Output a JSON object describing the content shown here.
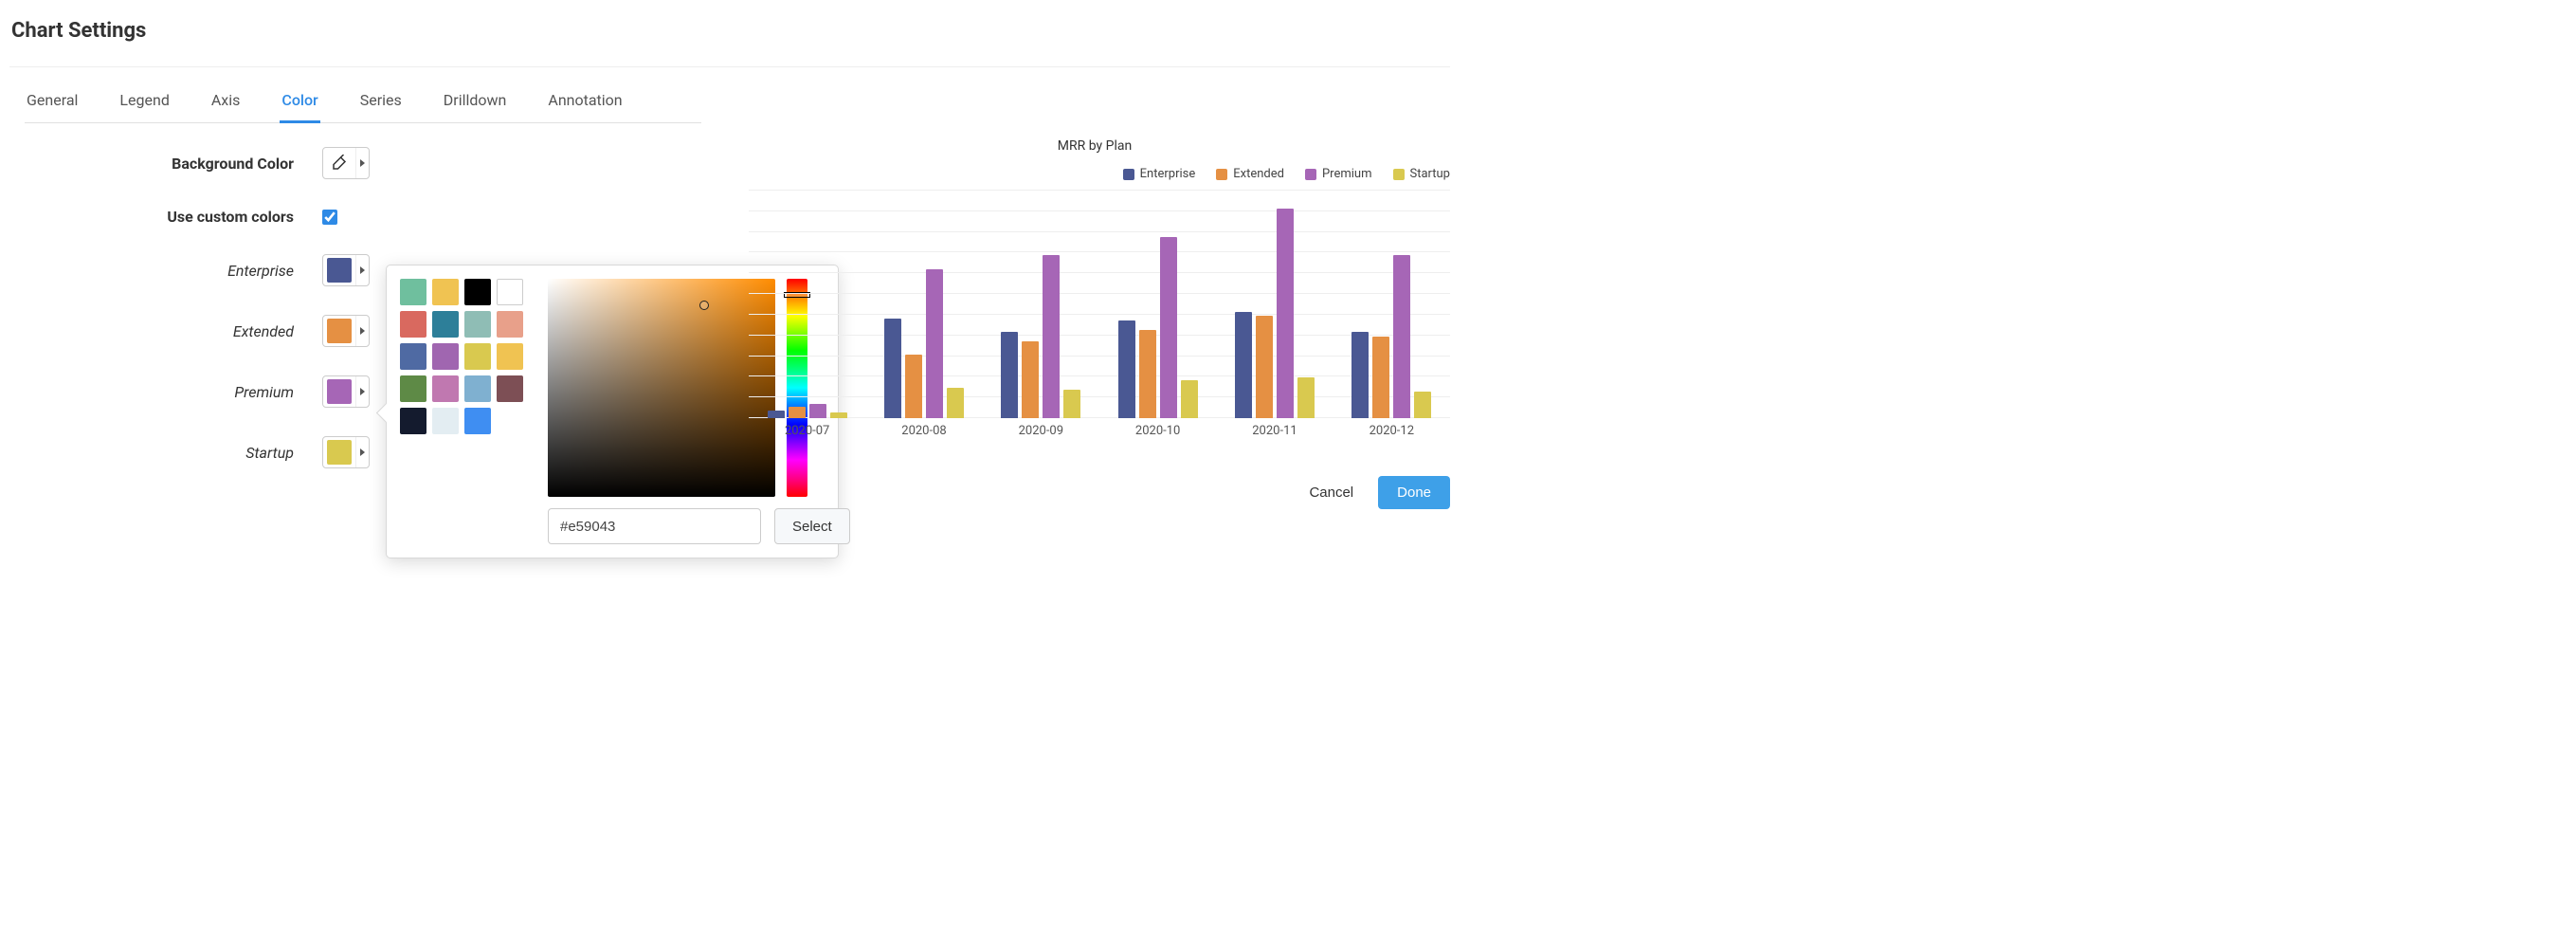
{
  "title": "Chart Settings",
  "tabs": [
    "General",
    "Legend",
    "Axis",
    "Color",
    "Series",
    "Drilldown",
    "Annotation"
  ],
  "active_tab": "Color",
  "form": {
    "background_label": "Background Color",
    "use_custom_label": "Use custom colors",
    "use_custom_checked": true,
    "series_rows": [
      {
        "label": "Enterprise",
        "color": "#4a5893"
      },
      {
        "label": "Extended",
        "color": "#e59043"
      },
      {
        "label": "Premium",
        "color": "#a666b6"
      },
      {
        "label": "Startup",
        "color": "#d9c94f"
      }
    ]
  },
  "picker": {
    "palette": [
      "#6fbf9e",
      "#f0c352",
      "#000000",
      "#ffffff",
      "#d9695f",
      "#2d7f99",
      "#8fbdb5",
      "#e8a08a",
      "#4f6aa3",
      "#a066b0",
      "#d9c94f",
      "#f0c352",
      "#5e8a46",
      "#c078b0",
      "#7fb0d0",
      "#7d4f55",
      "#141b2e",
      "#e3edf2",
      "#3f8ef2"
    ],
    "outlined_index": 3,
    "hex_value": "#e59043",
    "select_label": "Select"
  },
  "footer": {
    "cancel": "Cancel",
    "done": "Done"
  },
  "chart_data": {
    "type": "bar",
    "title": "MRR by Plan",
    "categories": [
      "2020-07",
      "2020-08",
      "2020-09",
      "2020-10",
      "2020-11",
      "2020-12"
    ],
    "series": [
      {
        "name": "Enterprise",
        "color": "#4a5893",
        "values": [
          800,
          10500,
          9100,
          10300,
          11200,
          9100
        ]
      },
      {
        "name": "Extended",
        "color": "#e59043",
        "values": [
          1200,
          6700,
          8100,
          9300,
          10800,
          8600
        ]
      },
      {
        "name": "Premium",
        "color": "#a666b6",
        "values": [
          1500,
          15700,
          17200,
          19100,
          22100,
          17200
        ]
      },
      {
        "name": "Startup",
        "color": "#d9c94f",
        "values": [
          600,
          3200,
          3000,
          4000,
          4300,
          2800
        ]
      }
    ],
    "ylim": [
      0,
      24000
    ],
    "grid_steps": 11
  }
}
